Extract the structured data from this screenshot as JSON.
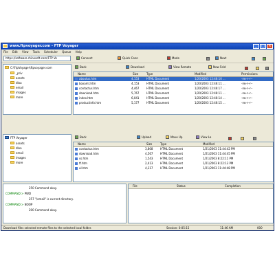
{
  "window": {
    "title": "www.ftpvoyager.com - FTP Voyager",
    "minimize": "_",
    "maximize": "□",
    "close": "×"
  },
  "menu": [
    "File",
    "Edit",
    "View",
    "Tools",
    "Scheduler",
    "Queue",
    "Help"
  ],
  "toolbar": {
    "address": "https://software.rhinosoft.com/FTP Vo",
    "connect": "Connect",
    "quick_connect": "Quick Conn",
    "mode": "Mode",
    "next": "Next"
  },
  "local_tree": {
    "root": "C:\\FtpVoyager\\ftpvoyager.com",
    "items": [
      "_priv",
      "assets",
      "dloa",
      "email",
      "images",
      "more"
    ]
  },
  "remote_tree": {
    "root": "FTP Voyager",
    "items": [
      "assets",
      "dloa",
      "email",
      "images",
      "more"
    ]
  },
  "top_list": {
    "toolbar": [
      "Back",
      "Download",
      "View Remote",
      "New Fold"
    ],
    "columns": [
      "Name",
      "Size",
      "Type",
      "Modified",
      "Permissions"
    ],
    "rows": [
      {
        "name": "aboutus.htm",
        "size": "4,153",
        "type": "HTML Document",
        "modified": "1/20/2003 12:46:10 ...",
        "perms": "-rw-r--r--"
      },
      {
        "name": "boxamt.htm",
        "size": "4,153",
        "type": "HTML Document",
        "modified": "1/20/2003 12:46:11 ...",
        "perms": "-rw-r--r--"
      },
      {
        "name": "contactus.htm",
        "size": "4,467",
        "type": "HTML Document",
        "modified": "1/20/2003 12:46:17 ...",
        "perms": "-rw-r--r--"
      },
      {
        "name": "download.htm",
        "size": "5,767",
        "type": "HTML Document",
        "modified": "1/20/2003 12:46:11 ...",
        "perms": "-rw-r--r--"
      },
      {
        "name": "index.htm",
        "size": "6,041",
        "type": "HTML Document",
        "modified": "1/20/2003 12:46:14 ...",
        "perms": "-rw-r--r--"
      },
      {
        "name": "productinfo.htm",
        "size": "5,177",
        "type": "HTML Document",
        "modified": "1/20/2003 12:46:15 ...",
        "perms": "-rw-r--r--"
      }
    ]
  },
  "bottom_list": {
    "toolbar": [
      "Back",
      "Upload",
      "Move Up",
      "View Lo"
    ],
    "columns": [
      "Name",
      "Size",
      "Type",
      "Modified"
    ],
    "rows": [
      {
        "name": "contactus.htm",
        "size": "3,808",
        "type": "HTML Document",
        "modified": "1/21/2003 11:44:42 PM"
      },
      {
        "name": "download.htm",
        "size": "4,567",
        "type": "HTML Document",
        "modified": "1/21/2003 11:44:45 PM"
      },
      {
        "name": "ss.htm",
        "size": "1,543",
        "type": "HTML Document",
        "modified": "1/21/2003 8:22:11 PM"
      },
      {
        "name": "tf.htm",
        "size": "2,413",
        "type": "HTML Document",
        "modified": "1/21/2003 8:22:13 PM"
      },
      {
        "name": "ul.htm",
        "size": "4,317",
        "type": "HTML Document",
        "modified": "1/21/2003 11:44:48 PM"
      }
    ]
  },
  "log": [
    {
      "prefix": "",
      "text": "250 Command okay."
    },
    {
      "prefix": "COMMAND:>",
      "text": "PWD"
    },
    {
      "prefix": "",
      "text": "257 \"/email\" is current directory."
    },
    {
      "prefix": "COMMAND:>",
      "text": "NOOP"
    },
    {
      "prefix": "",
      "text": "200 Command okay."
    }
  ],
  "queue": {
    "columns": [
      "File",
      "Status",
      "Completion"
    ]
  },
  "statusbar": {
    "message": "Download files selected remote files to the selected local folder.",
    "session": "Session: 0:05:15",
    "time": "11:46 AM",
    "progress_label": "000"
  },
  "colors": {
    "title_bar": "#0a3fb0",
    "selection": "#316ac5",
    "folder": "#f4d35e",
    "log_green": "#008000"
  }
}
